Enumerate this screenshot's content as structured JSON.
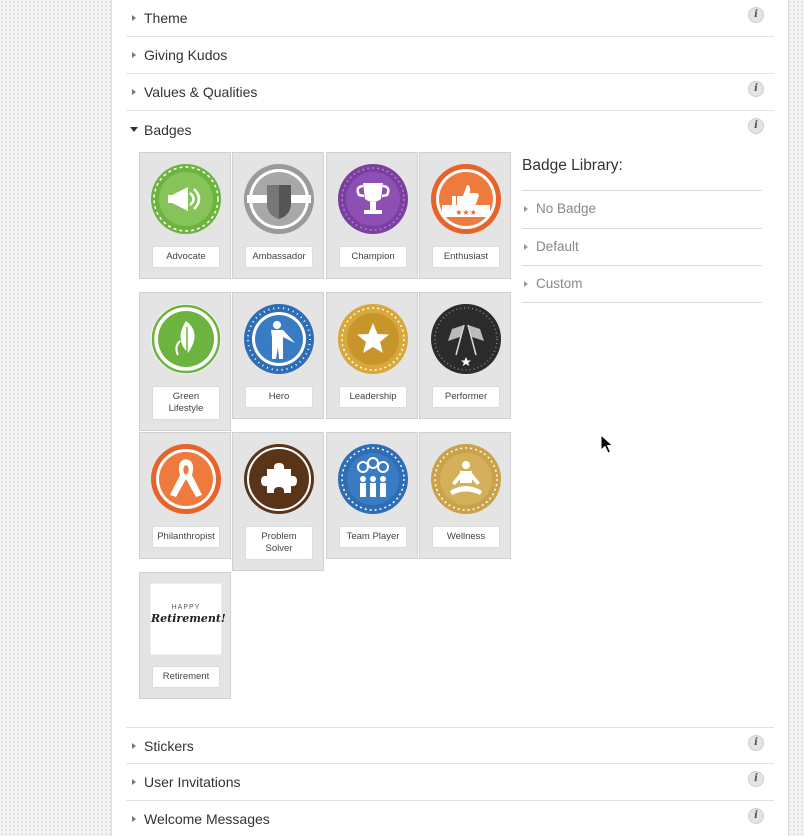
{
  "sections_top": [
    {
      "id": "theme",
      "label": "Theme",
      "info": true,
      "expanded": false
    },
    {
      "id": "giving-kudos",
      "label": "Giving Kudos",
      "info": false,
      "expanded": false
    },
    {
      "id": "values-qualities",
      "label": "Values & Qualities",
      "info": true,
      "expanded": false
    },
    {
      "id": "badges",
      "label": "Badges",
      "info": true,
      "expanded": true
    }
  ],
  "badges": [
    {
      "label": "Advocate",
      "icon": "megaphone-icon",
      "color": "#6db33f"
    },
    {
      "label": "Ambassador",
      "icon": "shield-icon",
      "color": "#9a9a9a"
    },
    {
      "label": "Champion",
      "icon": "trophy-icon",
      "color": "#7b3fa0"
    },
    {
      "label": "Enthusiast",
      "icon": "thumbs-up-icon",
      "color": "#e8632b"
    },
    {
      "label": "Green Lifestyle",
      "icon": "leaf-icon",
      "color": "#6db33f"
    },
    {
      "label": "Hero",
      "icon": "superhero-icon",
      "color": "#2f6eb5"
    },
    {
      "label": "Leadership",
      "icon": "star-icon",
      "color": "#d9a83a"
    },
    {
      "label": "Performer",
      "icon": "checkered-flags-icon",
      "color": "#2b2b2b"
    },
    {
      "label": "Philanthropist",
      "icon": "ribbon-icon",
      "color": "#e8632b"
    },
    {
      "label": "Problem Solver",
      "icon": "puzzle-icon",
      "color": "#5a3418"
    },
    {
      "label": "Team Player",
      "icon": "team-icon",
      "color": "#2f6eb5"
    },
    {
      "label": "Wellness",
      "icon": "meditation-icon",
      "color": "#c9a24a"
    },
    {
      "label": "Retirement",
      "icon": "happy-retirement-icon",
      "color": "#222222"
    }
  ],
  "retirement_art": {
    "line1": "HAPPY",
    "line2": "Retirement!"
  },
  "badge_library": {
    "title": "Badge Library:",
    "items": [
      "No Badge",
      "Default",
      "Custom"
    ]
  },
  "sections_bottom": [
    {
      "id": "stickers",
      "label": "Stickers",
      "info": true
    },
    {
      "id": "user-invitations",
      "label": "User Invitations",
      "info": true
    },
    {
      "id": "welcome-messages",
      "label": "Welcome Messages",
      "info": true
    }
  ],
  "info_glyph": "i"
}
